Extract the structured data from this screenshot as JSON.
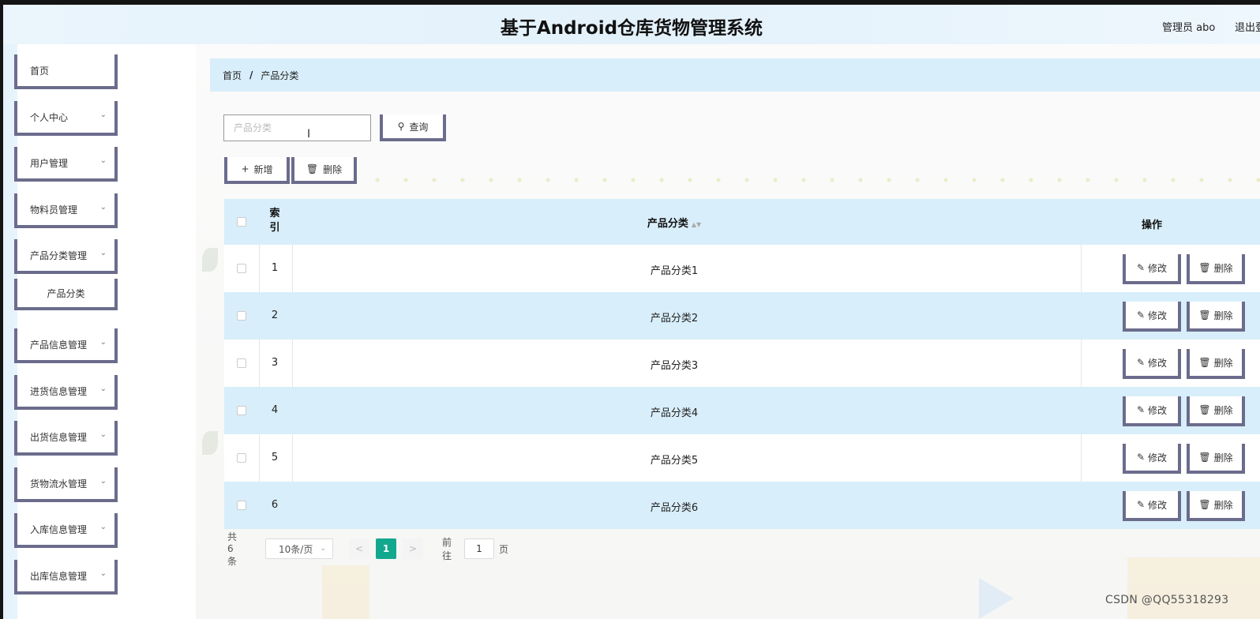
{
  "header": {
    "title": "基于Android仓库货物管理系统",
    "user": "管理员 abo",
    "logout": "退出登"
  },
  "sidebar": {
    "items": [
      {
        "label": "首页",
        "dropdown": false
      },
      {
        "label": "个人中心",
        "dropdown": true
      },
      {
        "label": "用户管理",
        "dropdown": true
      },
      {
        "label": "物料员管理",
        "dropdown": true
      },
      {
        "label": "产品分类管理",
        "dropdown": true
      },
      {
        "label": "产品分类",
        "dropdown": false,
        "sub": true
      },
      {
        "label": "产品信息管理",
        "dropdown": true
      },
      {
        "label": "进货信息管理",
        "dropdown": true
      },
      {
        "label": "出货信息管理",
        "dropdown": true
      },
      {
        "label": "货物流水管理",
        "dropdown": true
      },
      {
        "label": "入库信息管理",
        "dropdown": true
      },
      {
        "label": "出库信息管理",
        "dropdown": true
      }
    ]
  },
  "breadcrumb": {
    "home": "首页",
    "separator": "/",
    "current": "产品分类"
  },
  "search": {
    "placeholder": "产品分类",
    "value": "",
    "button_label": "查询"
  },
  "toolbar": {
    "add_label": "新增",
    "delete_label": "删除"
  },
  "table": {
    "columns": {
      "index": "索\n引",
      "category": "产品分类",
      "actions": "操作"
    },
    "rows": [
      {
        "index": "1",
        "category": "产品分类1"
      },
      {
        "index": "2",
        "category": "产品分类2"
      },
      {
        "index": "3",
        "category": "产品分类3"
      },
      {
        "index": "4",
        "category": "产品分类4"
      },
      {
        "index": "5",
        "category": "产品分类5"
      },
      {
        "index": "6",
        "category": "产品分类6"
      }
    ],
    "edit_label": "修改",
    "delete_label": "删除"
  },
  "pagination": {
    "total_text": "共 6 条",
    "page_size": "10条/页",
    "prev": "<",
    "current_page": "1",
    "next": ">",
    "goto_label": "前往",
    "goto_value": "1",
    "page_suffix": "页"
  },
  "watermark": "CSDN @QQ55318293",
  "colors": {
    "accent": "#12a88e",
    "header_bg": "#e3f1fb",
    "row_alt": "#d8eefa",
    "button_border": "#6b6c8c"
  }
}
